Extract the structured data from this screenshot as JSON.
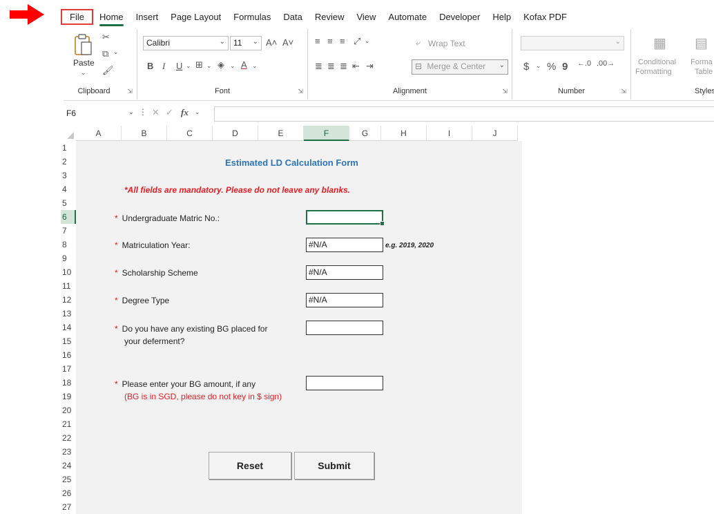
{
  "ribbon_tabs": [
    "File",
    "Home",
    "Insert",
    "Page Layout",
    "Formulas",
    "Data",
    "Review",
    "View",
    "Automate",
    "Developer",
    "Help",
    "Kofax PDF"
  ],
  "clipboard": {
    "paste_label": "Paste",
    "group_label": "Clipboard"
  },
  "font": {
    "name": "Calibri",
    "size": "11",
    "group_label": "Font"
  },
  "alignment": {
    "wrap_text": "Wrap Text",
    "merge_center": "Merge & Center",
    "group_label": "Alignment"
  },
  "number": {
    "currency": "$",
    "percent": "%",
    "comma": "9",
    "group_label": "Number"
  },
  "styles": {
    "conditional_1": "Conditional",
    "conditional_2": "Formatting",
    "format_1": "Forma",
    "format_2": "Table",
    "group_label": "Styles"
  },
  "formula_bar": {
    "cell_ref": "F6",
    "fx": "fx",
    "value": ""
  },
  "columns": [
    "A",
    "B",
    "C",
    "D",
    "E",
    "F",
    "G",
    "H",
    "I",
    "J"
  ],
  "rows": [
    "1",
    "2",
    "3",
    "4",
    "5",
    "6",
    "7",
    "8",
    "9",
    "10",
    "11",
    "12",
    "13",
    "14",
    "15",
    "16",
    "17",
    "18",
    "19",
    "20",
    "21",
    "22",
    "23",
    "24",
    "25",
    "26",
    "27"
  ],
  "form": {
    "title": "Estimated LD Calculation Form",
    "mandatory_note": "*All fields are mandatory. Please do not leave any blanks.",
    "star": "*",
    "matric_label": "Undergraduate Matric No.:",
    "matric_value": "",
    "year_label": "Matriculation Year:",
    "year_value": "#N/A",
    "year_example": "e.g. 2019, 2020",
    "scheme_label": "Scholarship Scheme",
    "scheme_value": "#N/A",
    "degree_label": "Degree Type",
    "degree_value": "#N/A",
    "bg_question_1": "Do you have any existing BG placed for",
    "bg_question_2": "your deferment?",
    "bg_existing_value": "",
    "bg_amount_label": "Please enter your BG amount, if any",
    "bg_amount_note": "(BG is in SGD, please do not key in $ sign)",
    "bg_amount_value": "",
    "reset_label": "Reset",
    "submit_label": "Submit"
  },
  "colors": {
    "accent": "#1e7145",
    "title_blue": "#2e75b6",
    "warning_red": "#e51c23",
    "arrow_red": "#ff0000"
  }
}
